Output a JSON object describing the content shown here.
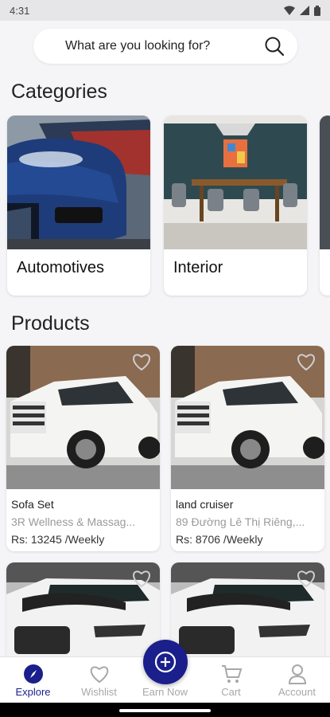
{
  "status_bar": {
    "time": "4:31"
  },
  "search": {
    "placeholder": "What are you looking for?"
  },
  "sections": {
    "categories": "Categories",
    "products": "Products"
  },
  "categories": [
    {
      "label": "Automotives"
    },
    {
      "label": "Interior"
    }
  ],
  "products": [
    {
      "name": "Sofa Set",
      "location": "3R Wellness & Massag...",
      "price": "Rs: 13245 /Weekly"
    },
    {
      "name": "land cruiser",
      "location": "89 Đường Lê Thị Riêng,...",
      "price": "Rs: 8706 /Weekly"
    },
    {
      "name": "",
      "location": "",
      "price": ""
    },
    {
      "name": "",
      "location": "",
      "price": ""
    }
  ],
  "bottom_nav": {
    "explore": "Explore",
    "wishlist": "Wishlist",
    "earn_now": "Earn Now",
    "cart": "Cart",
    "account": "Account",
    "active": "explore",
    "accent_color": "#1a1f8c",
    "inactive_color": "#a8a8a8"
  }
}
